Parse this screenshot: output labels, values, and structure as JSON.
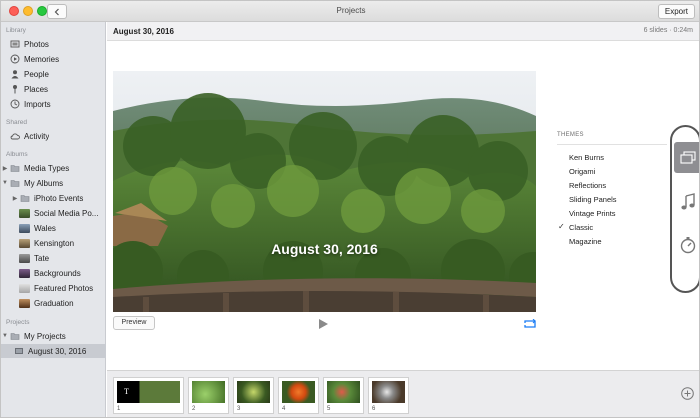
{
  "window": {
    "title": "Projects",
    "export_label": "Export"
  },
  "sidebar": {
    "library_title": "Library",
    "library": [
      {
        "label": "Photos",
        "icon": "photos-icon"
      },
      {
        "label": "Memories",
        "icon": "memories-icon"
      },
      {
        "label": "People",
        "icon": "people-icon"
      },
      {
        "label": "Places",
        "icon": "places-icon"
      },
      {
        "label": "Imports",
        "icon": "imports-icon"
      }
    ],
    "shared_title": "Shared",
    "shared": [
      {
        "label": "Activity",
        "icon": "cloud-icon"
      }
    ],
    "albums_title": "Albums",
    "albums": [
      {
        "label": "Media Types",
        "icon": "folder-icon"
      },
      {
        "label": "My Albums",
        "icon": "folder-icon"
      },
      {
        "label": "iPhoto Events",
        "icon": "folder-icon"
      },
      {
        "label": "Social Media Po...",
        "icon": "album-thumb-icon"
      },
      {
        "label": "Wales",
        "icon": "album-thumb-icon"
      },
      {
        "label": "Kensington",
        "icon": "album-thumb-icon"
      },
      {
        "label": "Tate",
        "icon": "album-thumb-icon"
      },
      {
        "label": "Backgrounds",
        "icon": "album-thumb-icon"
      },
      {
        "label": "Featured Photos",
        "icon": "album-thumb-icon"
      },
      {
        "label": "Graduation",
        "icon": "album-thumb-icon"
      }
    ],
    "projects_title": "Projects",
    "projects": [
      {
        "label": "My Projects",
        "icon": "folder-icon"
      },
      {
        "label": "August 30, 2016",
        "icon": "slideshow-icon"
      }
    ]
  },
  "header": {
    "project_date": "August 30, 2016",
    "slide_info": "6 slides · 0:24m"
  },
  "preview": {
    "overlay_title": "August 30, 2016",
    "preview_label": "Preview"
  },
  "themes": {
    "title": "THEMES",
    "items": [
      "Ken Burns",
      "Origami",
      "Reflections",
      "Sliding Panels",
      "Vintage Prints",
      "Classic",
      "Magazine"
    ],
    "selected": "Classic"
  },
  "filmstrip": {
    "slides": [
      "1",
      "2",
      "3",
      "4",
      "5",
      "6"
    ]
  },
  "colors": {
    "accent": "#1a7cf5",
    "sidebar_bg": "#e4e6ea",
    "selected_row": "#c8cbd1"
  }
}
